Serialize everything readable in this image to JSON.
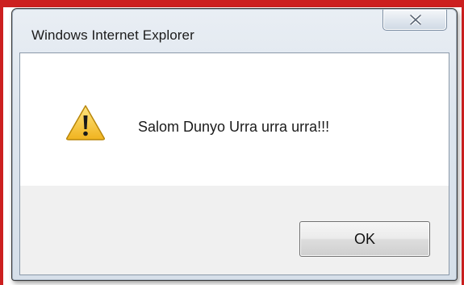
{
  "dialog": {
    "title": "Windows Internet Explorer",
    "message": "Salom Dunyo Urra urra urra!!!",
    "ok_label": "OK",
    "icon": "warning-icon",
    "close_icon": "close-icon"
  },
  "colors": {
    "page_border": "#cc1f1f",
    "warning_fill": "#f6c83a",
    "warning_mark": "#1a1a1a"
  }
}
